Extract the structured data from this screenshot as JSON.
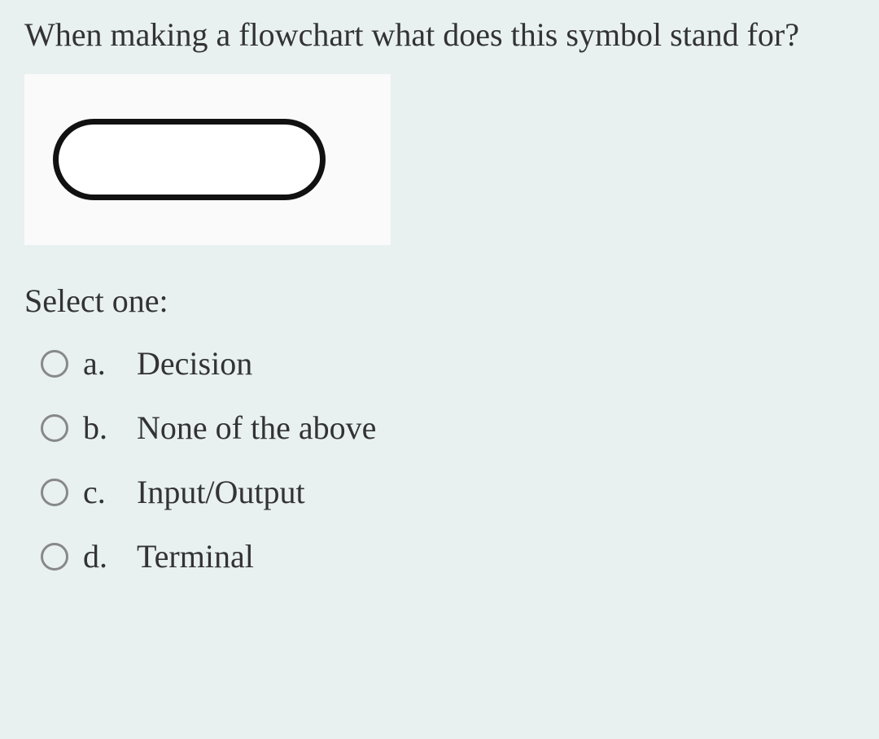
{
  "question": {
    "text": "When making a flowchart what does this symbol stand for?",
    "select_prompt": "Select one:"
  },
  "options": [
    {
      "letter": "a.",
      "text": "Decision"
    },
    {
      "letter": "b.",
      "text": "None of the above"
    },
    {
      "letter": "c.",
      "text": "Input/Output"
    },
    {
      "letter": "d.",
      "text": "Terminal"
    }
  ]
}
